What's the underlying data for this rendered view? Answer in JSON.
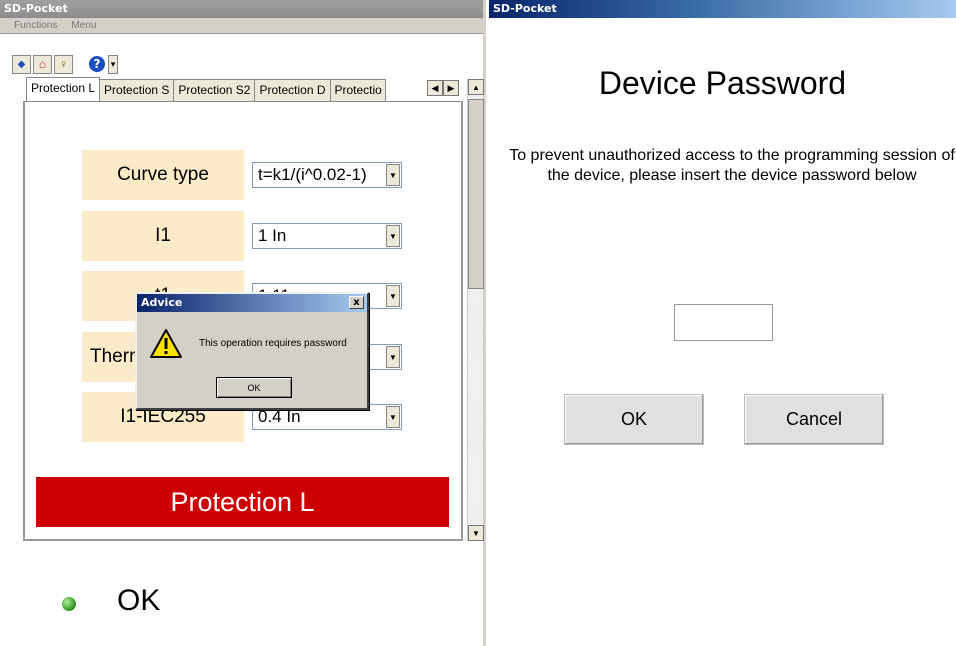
{
  "left_window": {
    "title": "SD-Pocket",
    "menu": [
      "Functions",
      "Menu"
    ],
    "toolbar": {
      "icons": [
        "back-icon",
        "home-icon",
        "bulb-icon",
        "help-icon",
        "dropdown-icon"
      ],
      "glyphs": [
        "◆",
        "⌂",
        "♀",
        "❓",
        "▾"
      ]
    },
    "tabs": [
      "Protection L",
      "Protection S",
      "Protection S2",
      "Protection D",
      "Protectio"
    ],
    "rows": [
      {
        "label": "Curve type",
        "value": "t=k1/(i^0.02-1)"
      },
      {
        "label": "I1",
        "value": "1 In"
      },
      {
        "label": "t1",
        "value": "1.11"
      },
      {
        "label": "Thermal memory",
        "value": ""
      },
      {
        "label": "I1-IEC255",
        "value": "0.4 In"
      }
    ],
    "banner": "Protection L",
    "status": "OK"
  },
  "dialog": {
    "title": "Advice",
    "message": "This operation requires password",
    "ok_label": "OK",
    "close_glyph": "x"
  },
  "right_window": {
    "title": "SD-Pocket",
    "heading": "Device Password",
    "message": "To prevent unauthorized access to the programming session of the device, please insert the device password below",
    "password_value": "",
    "ok_label": "OK",
    "cancel_label": "Cancel"
  },
  "colors": {
    "banner_red": "#cc0000",
    "label_bg": "#fcebc8",
    "status_green": "#3c9a2a"
  }
}
